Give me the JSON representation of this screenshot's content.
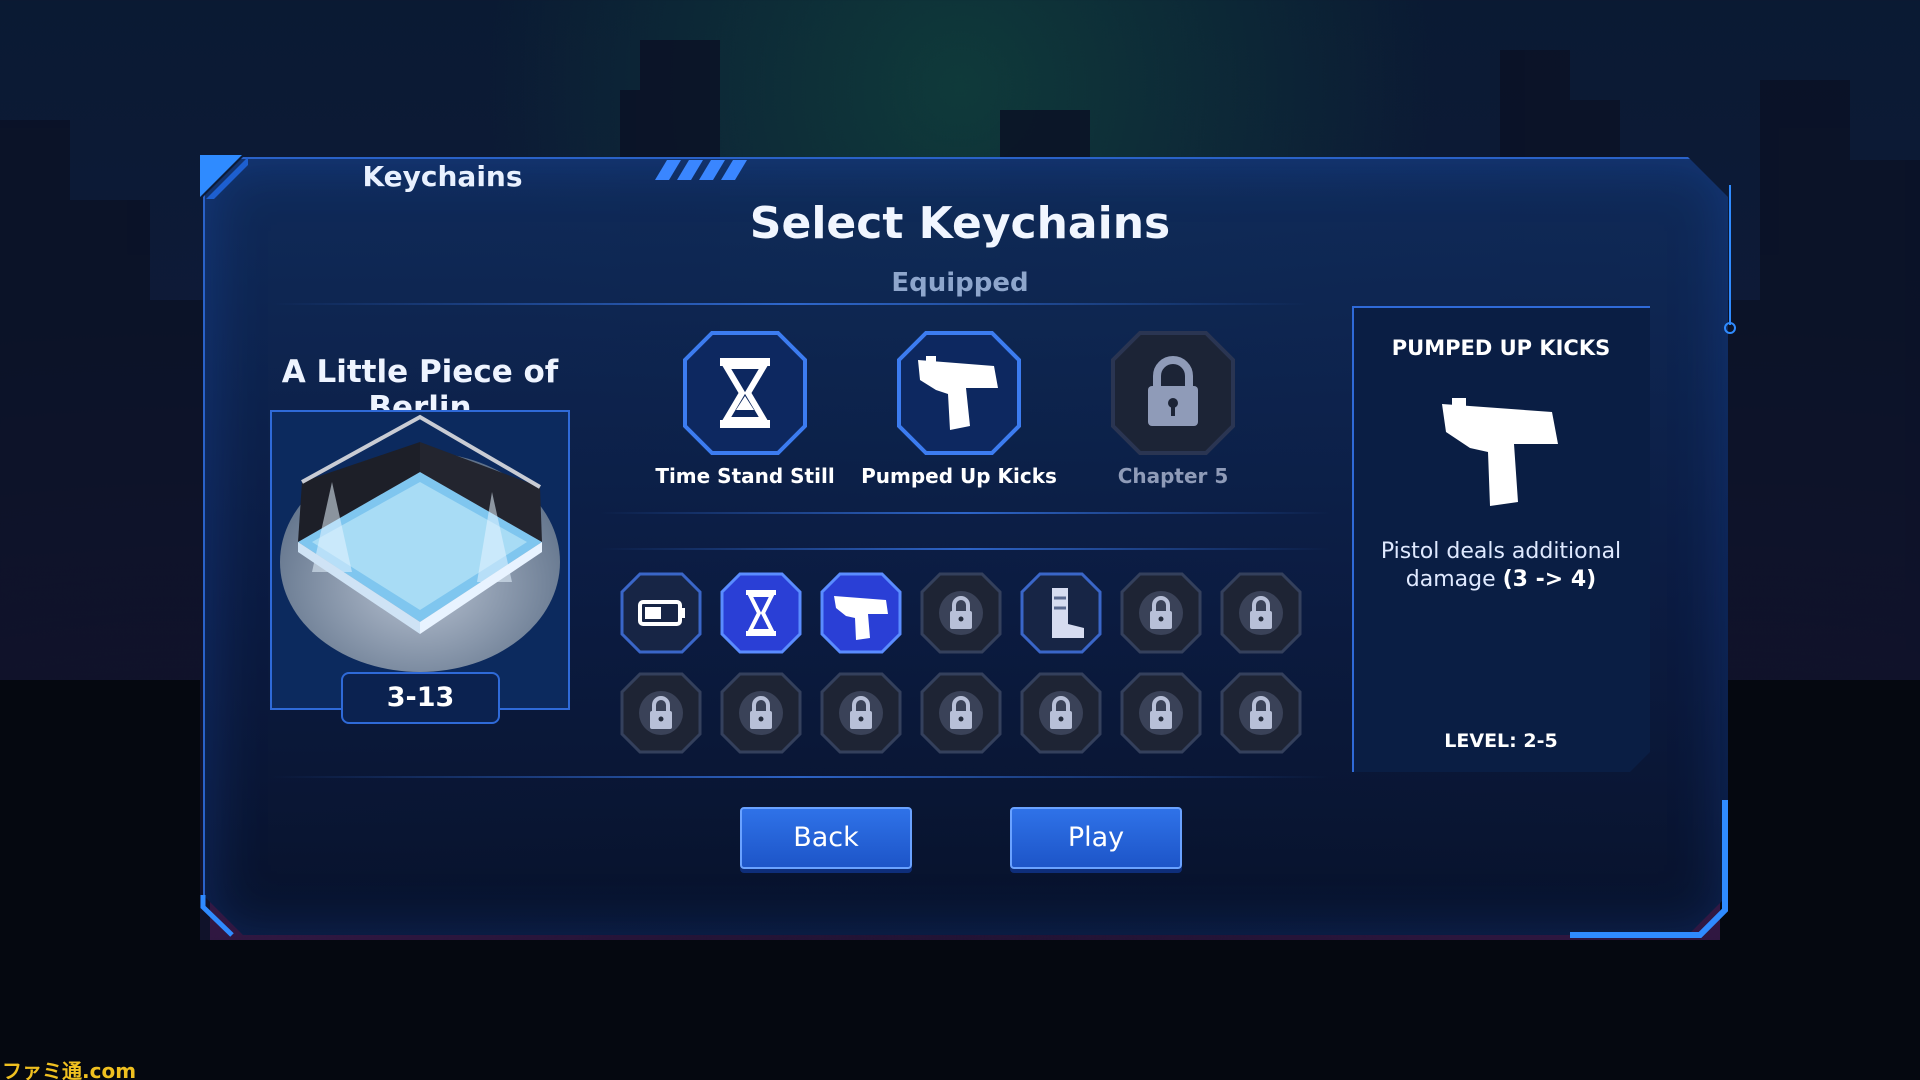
{
  "tab": {
    "label": "Keychains"
  },
  "title": "Select Keychains",
  "equipped_label": "Equipped",
  "level": {
    "name": "A Little Piece of Berlin",
    "code": "3-13"
  },
  "equipped_slots": [
    {
      "label": "Time Stand Still",
      "icon": "hourglass-icon",
      "locked": false
    },
    {
      "label": "Pumped Up Kicks",
      "icon": "pistol-icon",
      "locked": false
    },
    {
      "label": "Chapter 5",
      "icon": "lock-icon",
      "locked": true
    }
  ],
  "keychain_grid": [
    {
      "icon": "battery-icon",
      "locked": false,
      "selected": false
    },
    {
      "icon": "hourglass-icon",
      "locked": false,
      "selected": true
    },
    {
      "icon": "pistol-icon",
      "locked": false,
      "selected": true
    },
    {
      "icon": "heart-lock-icon",
      "locked": true,
      "selected": false
    },
    {
      "icon": "boot-icon",
      "locked": false,
      "selected": false
    },
    {
      "icon": "knife-lock-icon",
      "locked": true,
      "selected": false
    },
    {
      "icon": "tag-lock-icon",
      "locked": true,
      "selected": false
    },
    {
      "icon": "cassette-lock-icon",
      "locked": true,
      "selected": false
    },
    {
      "icon": "film-lock-icon",
      "locked": true,
      "selected": false
    },
    {
      "icon": "arrow-lock-icon",
      "locked": true,
      "selected": false
    },
    {
      "icon": "drop-lock-icon",
      "locked": true,
      "selected": false
    },
    {
      "icon": "star-lock-icon",
      "locked": true,
      "selected": false
    },
    {
      "icon": "moon-lock-icon",
      "locked": true,
      "selected": false
    },
    {
      "icon": "shield-lock-icon",
      "locked": true,
      "selected": false
    }
  ],
  "info": {
    "title": "PUMPED UP KICKS",
    "icon": "pistol-icon",
    "desc_prefix": "Pistol deals additional damage ",
    "desc_bold": "(3 -> 4)",
    "level": "LEVEL: 2-5"
  },
  "buttons": {
    "back": "Back",
    "play": "Play"
  },
  "watermark": "ファミ通.com",
  "colors": {
    "accent": "#2f6ad8",
    "button": "#2f72e8",
    "selected_slot": "#2a44d8"
  }
}
